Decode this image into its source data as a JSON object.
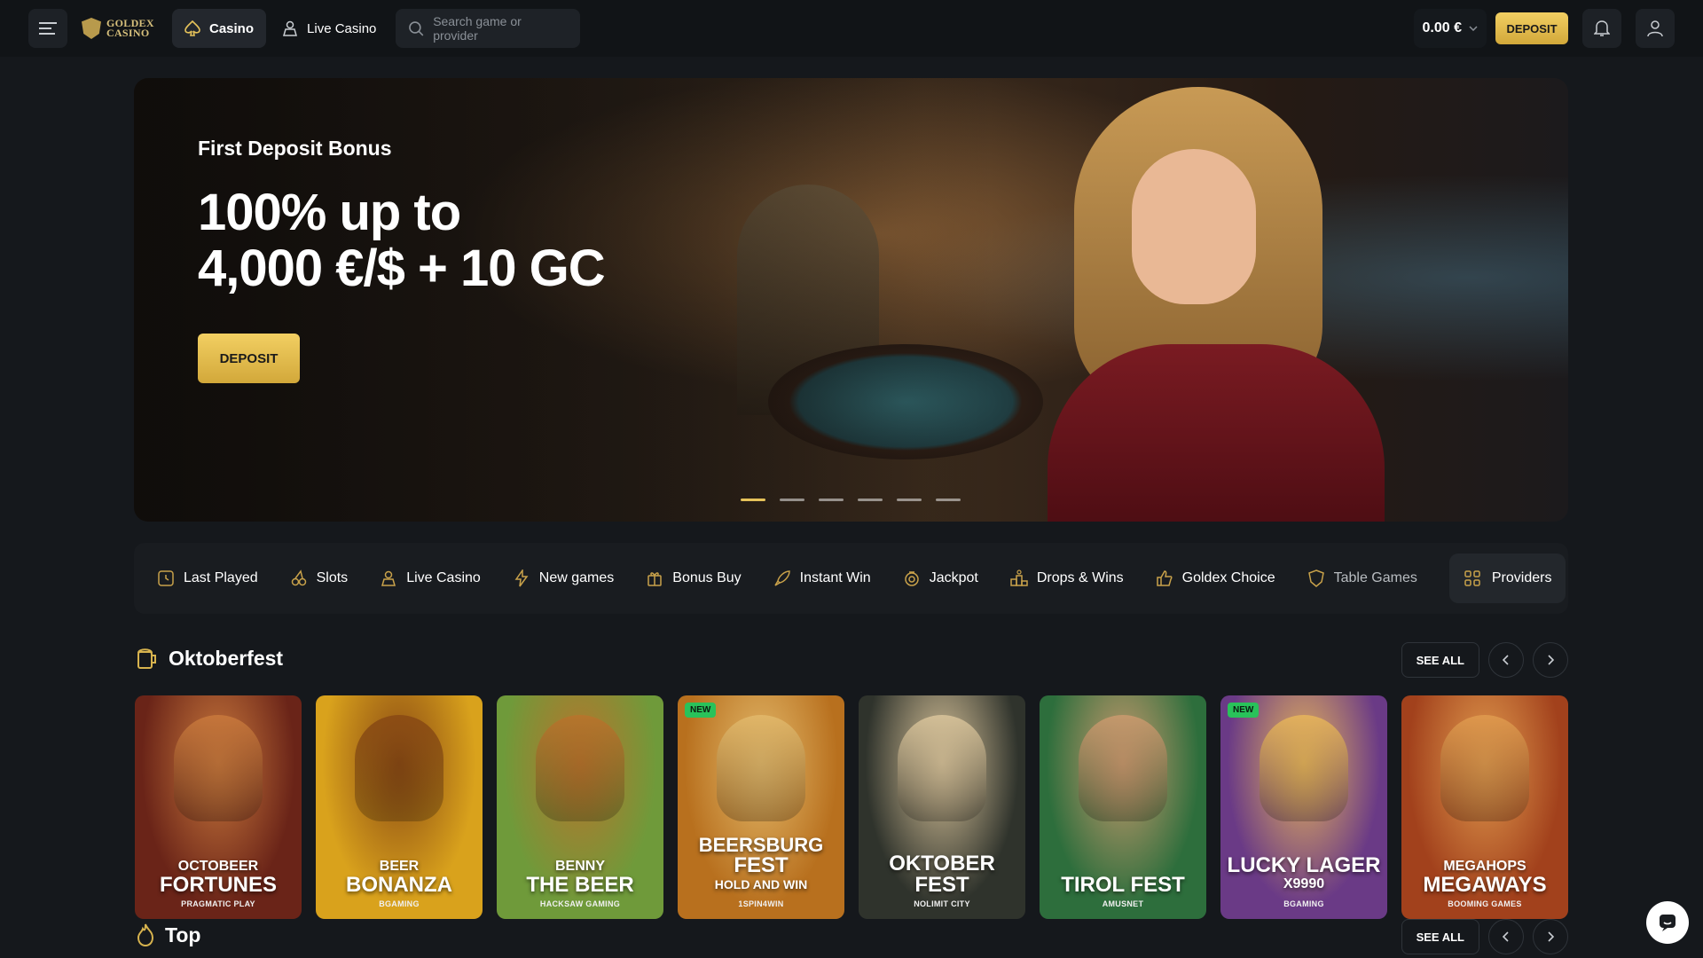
{
  "header": {
    "logo_line1": "GOLDEX",
    "logo_line2": "CASINO",
    "tabs": [
      {
        "label": "Casino",
        "icon": "spade-icon"
      },
      {
        "label": "Live Casino",
        "icon": "dealer-icon"
      }
    ],
    "search_placeholder": "Search game or provider",
    "balance": "0.00 €",
    "deposit_label": "DEPOSIT"
  },
  "hero": {
    "subtitle": "First Deposit Bonus",
    "title_line1": "100% up to",
    "title_line2": "4,000 €/$ + 10 GC",
    "button": "DEPOSIT",
    "slides_count": 6,
    "active_slide": 1
  },
  "categories": [
    {
      "label": "Last Played",
      "icon": "clock-icon"
    },
    {
      "label": "Slots",
      "icon": "cherry-icon"
    },
    {
      "label": "Live Casino",
      "icon": "dealer-icon"
    },
    {
      "label": "New games",
      "icon": "lightning-icon"
    },
    {
      "label": "Bonus Buy",
      "icon": "gift-icon"
    },
    {
      "label": "Instant Win",
      "icon": "rocket-icon"
    },
    {
      "label": "Jackpot",
      "icon": "coin-icon"
    },
    {
      "label": "Drops & Wins",
      "icon": "podium-icon"
    },
    {
      "label": "Goldex Choice",
      "icon": "thumbs-up-icon"
    },
    {
      "label": "Table Games",
      "icon": "shield-icon"
    }
  ],
  "providers_label": "Providers",
  "section1": {
    "title": "Oktoberfest",
    "see_all": "SEE ALL",
    "games": [
      {
        "pre": "OCTOBEER",
        "name": "FORTUNES",
        "provider": "PRAGMATIC PLAY",
        "new": false,
        "bg": "#6a2418",
        "accent": "#c8783c"
      },
      {
        "pre": "BEER",
        "name": "BONANZA",
        "provider": "BGAMING",
        "new": false,
        "bg": "#d9a21c",
        "accent": "#8a4a14"
      },
      {
        "pre": "BENNY",
        "name": "THE BEER",
        "provider": "HACKSAW GAMING",
        "new": false,
        "bg": "#6f9a3a",
        "accent": "#b8742c"
      },
      {
        "pre": "BEERSBURG",
        "name": "FEST",
        "post": "HOLD AND WIN",
        "provider": "1SPIN4WIN",
        "new": true,
        "bg": "#b8701e",
        "accent": "#e2b86a"
      },
      {
        "pre": "OKTOBER",
        "name": "FEST",
        "provider": "NOLIMIT CITY",
        "new": false,
        "bg": "#2f332c",
        "accent": "#d8c39a"
      },
      {
        "pre": "",
        "name": "TIROL FEST",
        "provider": "AMUSNET",
        "new": false,
        "bg": "#2d6e3c",
        "accent": "#c99a6e"
      },
      {
        "pre": "",
        "name": "LUCKY LAGER",
        "post": "X9990",
        "provider": "BGAMING",
        "new": true,
        "bg": "#6a3a86",
        "accent": "#e6b45c"
      },
      {
        "pre": "MEGAHOPS",
        "name": "MEGAWAYS",
        "provider": "BOOMING GAMES",
        "new": false,
        "bg": "#a2411c",
        "accent": "#e09a4e"
      }
    ]
  },
  "section2": {
    "title": "Top",
    "see_all": "SEE ALL"
  },
  "new_badge": "NEW"
}
